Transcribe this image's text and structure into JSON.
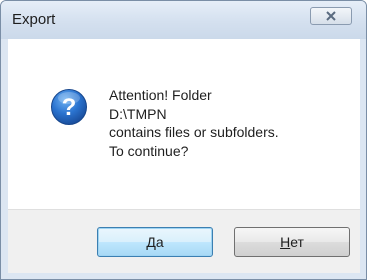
{
  "window": {
    "title": "Export",
    "close_icon": "close-icon"
  },
  "message": {
    "icon": "question-icon",
    "lines": [
      "Attention! Folder",
      "D:\\TMPN",
      "contains files or subfolders.",
      "To continue?"
    ]
  },
  "buttons": {
    "yes_label": "Да",
    "no_label_underlined": "Н",
    "no_label_rest": "ет"
  },
  "colors": {
    "titlebar": "#d4e0ef",
    "default_button_border": "#3c7fb1",
    "icon_blue": "#1f5fb8"
  }
}
